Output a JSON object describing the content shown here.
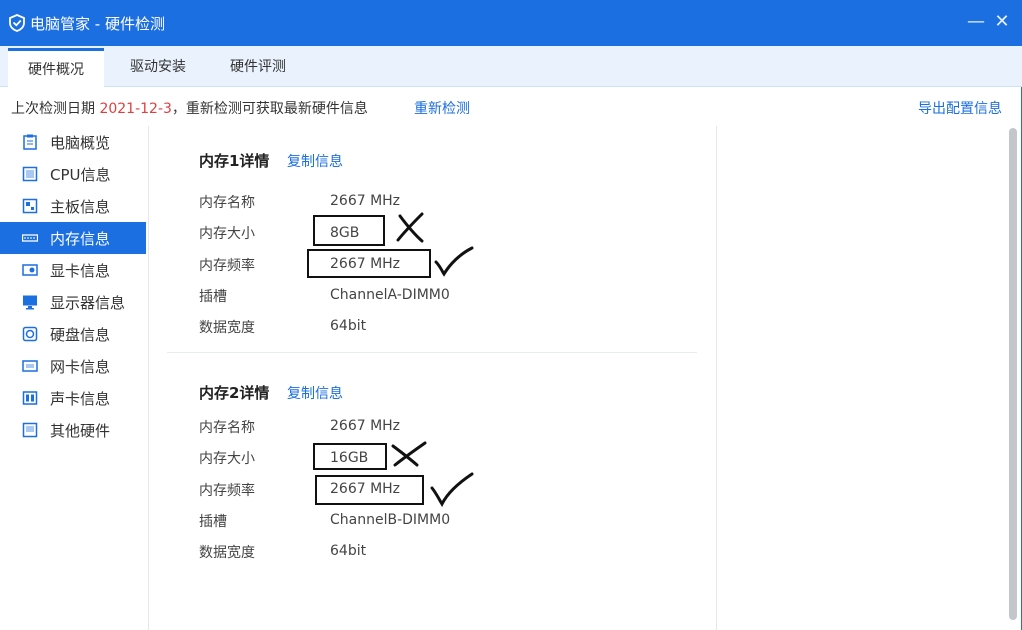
{
  "app": {
    "title": "电脑管家 - 硬件检测",
    "min_symbol": "—",
    "close_symbol": "✕"
  },
  "tabs": [
    {
      "label": "硬件概况",
      "active": true
    },
    {
      "label": "驱动安装",
      "active": false
    },
    {
      "label": "硬件评测",
      "active": false
    }
  ],
  "infobar": {
    "prefix": "上次检测日期 ",
    "date": "2021-12-3",
    "suffix": "，重新检测可获取最新硬件信息",
    "recheck_label": "重新检测",
    "export_label": "导出配置信息"
  },
  "sidebar": {
    "items": [
      {
        "label": "电脑概览",
        "icon": "clipboard-icon",
        "active": false
      },
      {
        "label": "CPU信息",
        "icon": "cpu-icon",
        "active": false
      },
      {
        "label": "主板信息",
        "icon": "motherboard-icon",
        "active": false
      },
      {
        "label": "内存信息",
        "icon": "memory-icon",
        "active": true
      },
      {
        "label": "显卡信息",
        "icon": "graphics-card-icon",
        "active": false
      },
      {
        "label": "显示器信息",
        "icon": "monitor-icon",
        "active": false
      },
      {
        "label": "硬盘信息",
        "icon": "disk-icon",
        "active": false
      },
      {
        "label": "网卡信息",
        "icon": "network-card-icon",
        "active": false
      },
      {
        "label": "声卡信息",
        "icon": "sound-card-icon",
        "active": false
      },
      {
        "label": "其他硬件",
        "icon": "other-hardware-icon",
        "active": false
      }
    ]
  },
  "memory": [
    {
      "title": "内存1详情",
      "copy_label": "复制信息",
      "rows": [
        {
          "label": "内存名称",
          "value": "2667 MHz"
        },
        {
          "label": "内存大小",
          "value": "8GB"
        },
        {
          "label": "内存频率",
          "value": "2667 MHz"
        },
        {
          "label": "插槽",
          "value": "ChannelA-DIMM0"
        },
        {
          "label": "数据宽度",
          "value": "64bit"
        }
      ]
    },
    {
      "title": "内存2详情",
      "copy_label": "复制信息",
      "rows": [
        {
          "label": "内存名称",
          "value": "2667 MHz"
        },
        {
          "label": "内存大小",
          "value": "16GB"
        },
        {
          "label": "内存频率",
          "value": "2667 MHz"
        },
        {
          "label": "插槽",
          "value": "ChannelB-DIMM0"
        },
        {
          "label": "数据宽度",
          "value": "64bit"
        }
      ]
    }
  ],
  "colors": {
    "accent": "#1c6fe0",
    "date": "#e03f3f",
    "annotation": "#111111"
  }
}
